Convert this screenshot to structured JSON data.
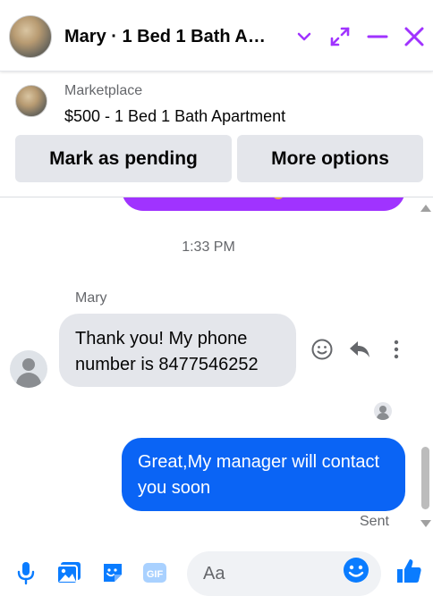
{
  "header": {
    "title": "Mary · 1 Bed 1 Bath A…"
  },
  "marketplace": {
    "label": "Marketplace",
    "listing": "$500 - 1 Bed 1 Bath Apartment",
    "mark_pending_label": "Mark as pending",
    "more_options_label": "More options"
  },
  "chat": {
    "timestamp": "1:33 PM",
    "messages": [
      {
        "sender": "Mary",
        "text": "Thank you! My phone number is 8477546252",
        "direction": "incoming"
      },
      {
        "sender": "",
        "text": "Great,My manager will contact you soon",
        "direction": "outgoing",
        "status": "Sent"
      }
    ]
  },
  "composer": {
    "placeholder": "Aa"
  },
  "colors": {
    "accent": "#a033ff",
    "outgoing_bubble": "#0a64f5",
    "incoming_bubble": "#e4e6eb",
    "icon_blue": "#0a7cff"
  },
  "icons": [
    "chevron-down-icon",
    "expand-icon",
    "minimize-icon",
    "close-icon",
    "emoji-react-icon",
    "reply-icon",
    "more-icon",
    "microphone-icon",
    "image-icon",
    "sticker-icon",
    "gif-icon",
    "emoji-icon",
    "thumbs-up-icon"
  ]
}
